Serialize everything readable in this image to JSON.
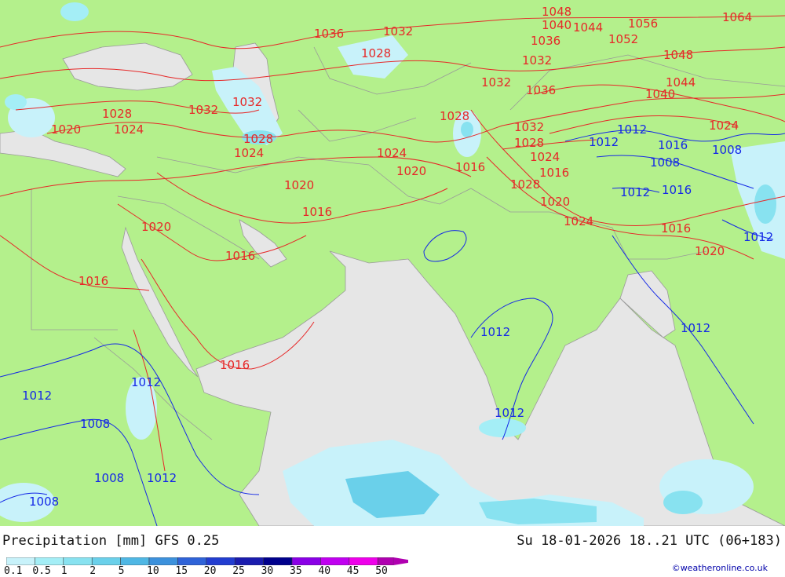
{
  "footer": {
    "title": "Precipitation [mm]  GFS 0.25",
    "valid": "Su 18-01-2026 18..21 UTC (06+183)",
    "credit": "©weatheronline.co.uk"
  },
  "legend": {
    "ticks": [
      "0.1",
      "0.5",
      "1",
      "2",
      "5",
      "10",
      "15",
      "20",
      "25",
      "30",
      "35",
      "40",
      "45",
      "50"
    ],
    "colors": [
      "#c8f2fa",
      "#a4eef6",
      "#88e2f0",
      "#6ad0ea",
      "#4fb7e4",
      "#3c91dc",
      "#2f63d8",
      "#223dd0",
      "#1a1cae",
      "#00008c",
      "#8a00e6",
      "#c000f0",
      "#ee00ea",
      "#b000b0"
    ]
  },
  "colors": {
    "land": "#b4f08c",
    "sea": "#e6e6e6",
    "high_pressure_isobar": "#e62828",
    "low_pressure_isobar": "#1428e6",
    "border": "#999999"
  },
  "isobars_red": [
    "1048",
    "1040",
    "1044",
    "1056",
    "1064",
    "1036",
    "1032",
    "1052",
    "1028",
    "1048",
    "1036",
    "1032",
    "1044",
    "1032",
    "1036",
    "1040",
    "1028",
    "1028",
    "1032",
    "1024",
    "1032",
    "1028",
    "1020",
    "1024",
    "1032",
    "1024",
    "1028",
    "1024",
    "1020",
    "1016",
    "1024",
    "1016",
    "1028",
    "1020",
    "1020",
    "1016",
    "1020",
    "1016",
    "1016",
    "1024",
    "1016",
    "1020",
    "1016"
  ],
  "isobars_blue": [
    "1012",
    "1012",
    "1016",
    "1008",
    "1008",
    "1012",
    "1016",
    "1012",
    "1012",
    "1012",
    "1012",
    "1012",
    "1012",
    "1008",
    "1008",
    "1012",
    "1008"
  ]
}
